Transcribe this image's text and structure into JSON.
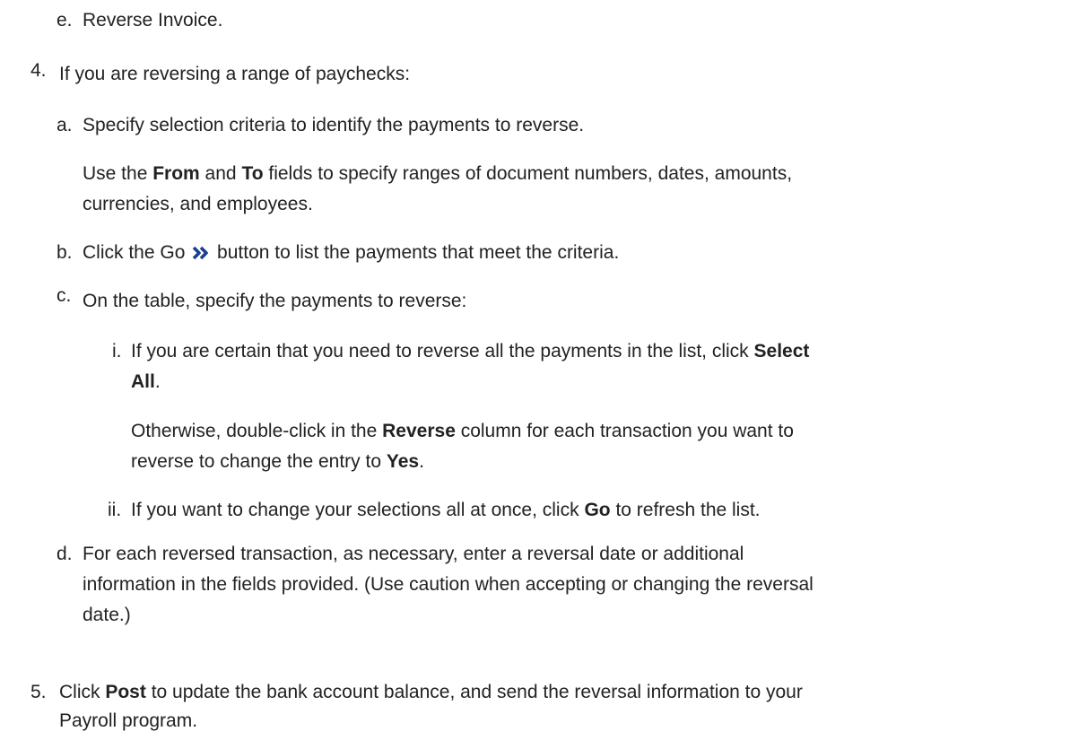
{
  "step3": {
    "e": {
      "marker": "e.",
      "text": "Reverse Invoice."
    }
  },
  "step4": {
    "marker": "4.",
    "text": "If you are reversing a range of paychecks:",
    "a": {
      "marker": "a.",
      "text": "Specify selection criteria to identify the payments to reverse.",
      "note_part1": "Use the ",
      "note_from": "From",
      "note_part2": " and ",
      "note_to": "To",
      "note_part3": " fields to specify ranges of document numbers, dates, amounts,",
      "note_line2": "currencies, and employees."
    },
    "b": {
      "marker": "b.",
      "text_before": "Click the Go ",
      "icon": "double-chevron-right-icon",
      "text_after": " button to list the payments that meet the criteria."
    },
    "c": {
      "marker": "c.",
      "text": "On the table, specify the payments to reverse:",
      "i": {
        "marker": "i.",
        "line1_part1": "If you are certain that you need to reverse all the payments in the list, click ",
        "line1_bold": "Select",
        "line2_bold": "All",
        "line2_rest": ".",
        "other_part1": "Otherwise, double-click in the ",
        "other_bold1": "Reverse",
        "other_part2": " column for each transaction you want to",
        "other_line2_part1": "reverse to change the entry to ",
        "other_bold2": "Yes",
        "other_line2_part2": "."
      },
      "ii": {
        "marker": "ii.",
        "part1": "If you want to change your selections all at once, click ",
        "bold": "Go",
        "part2": " to refresh the list."
      }
    },
    "d": {
      "marker": "d.",
      "line1": "For each reversed transaction, as necessary, enter a reversal date or additional",
      "line2": "information in the fields provided. (Use caution when accepting or changing the reversal",
      "line3": "date.)"
    }
  },
  "step5": {
    "marker": "5.",
    "part1": "Click ",
    "bold": "Post",
    "part2": " to update the bank account balance, and send the reversal information to your",
    "line2": "Payroll program."
  },
  "colors": {
    "text": "#222222",
    "icon": "#1b3f8f"
  }
}
